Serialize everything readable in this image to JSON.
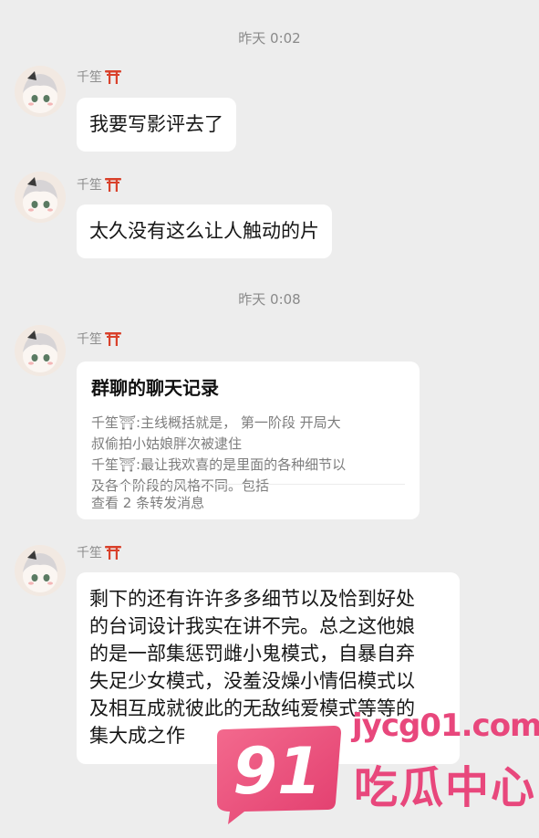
{
  "timestamps": [
    "昨天 0:02",
    "昨天 0:08"
  ],
  "sender_name": "千笙",
  "messages": [
    {
      "text": "我要写影评去了"
    },
    {
      "text": "太久没有这么让人触动的片"
    }
  ],
  "forward_card": {
    "title": "群聊的聊天记录",
    "lines": [
      "千笙⛩:主线概括就是，  第一阶段 开局大",
      "叔偷拍小姑娘胖次被逮住",
      "千笙⛩:最让我欢喜的是里面的各种细节以",
      "及各个阶段的风格不同。包括"
    ],
    "footer": "查看 2 条转发消息"
  },
  "long_message": {
    "lines": [
      "剩下的还有许许多多细节以及恰到好处",
      "的台词设计我实在讲不完。总之这他娘",
      "的是一部集惩罚雌小鬼模式，自暴自弃",
      "失足少女模式，没羞没燥小情侣模式以",
      "及相互成就彼此的无敌纯爱模式等等的",
      "集大成之作"
    ]
  },
  "watermark": {
    "badge": "91",
    "url": "jycg01.com",
    "name": "吃瓜中心"
  },
  "colors": {
    "background": "#ededed",
    "bubble": "#ffffff",
    "watermark": "#e8477c",
    "torii": "#d9412b"
  },
  "icons": {
    "torii": "torii-gate-emoji",
    "avatar": "anime-girl-avatar"
  }
}
